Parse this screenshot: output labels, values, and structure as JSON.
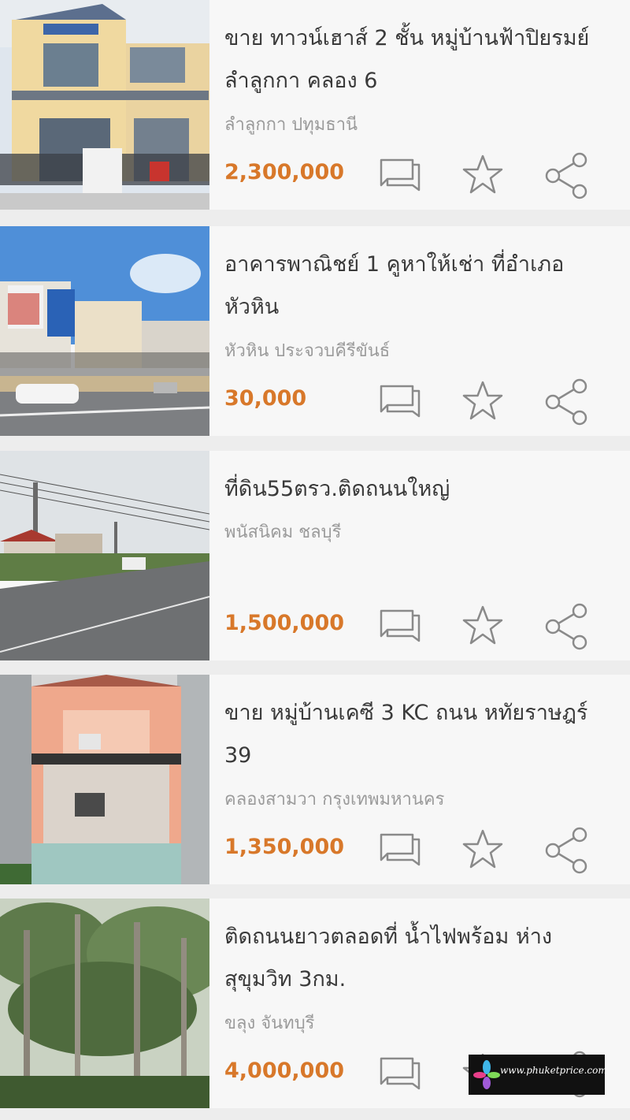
{
  "listings": [
    {
      "title": "ขาย ทาวน์เฮาส์ 2 ชั้น  หมู่บ้านฟ้าปิยรมย์ ลำลูกกา คลอง 6",
      "location": "ลำลูกกา ปทุมธานี",
      "price": "2,300,000"
    },
    {
      "title": "อาคารพาณิชย์ 1 คูหาให้เช่า ที่อำเภอหัวหิน",
      "location": "หัวหิน ประจวบคีรีขันธ์",
      "price": "30,000"
    },
    {
      "title": "ที่ดิน55ตรว.ติดถนนใหญ่",
      "location": "พนัสนิคม ชลบุรี",
      "price": "1,500,000"
    },
    {
      "title": "ขาย หมู่บ้านเคซี 3 KC  ถนน หทัยราษฎร์ 39",
      "location": "คลองสามวา กรุงเทพมหานคร",
      "price": "1,350,000"
    },
    {
      "title": "ติดถนนยาวตลอดที่ น้ำไฟพร้อม ห่างสุขุมวิท 3กม.",
      "location": "ขลุง จันทบุรี",
      "price": "4,000,000"
    }
  ],
  "watermark": {
    "text": "www.phuketprice.com"
  },
  "colors": {
    "price": "#d8782a",
    "icon": "#8a8a8a",
    "background": "#ededed",
    "card": "#f7f7f7"
  }
}
